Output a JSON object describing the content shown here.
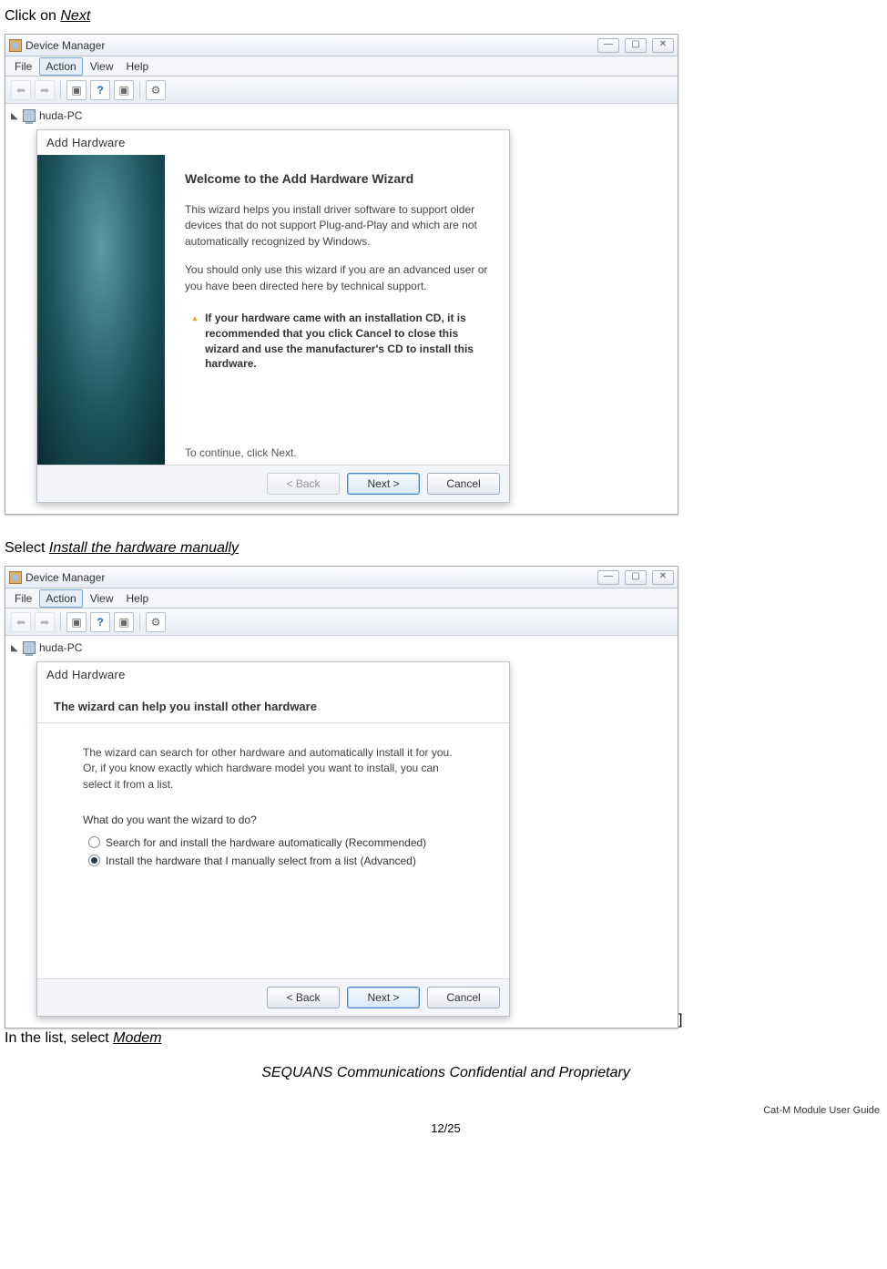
{
  "instruction1_prefix": "Click on ",
  "instruction1_link": "Next",
  "instruction2_prefix": "Select ",
  "instruction2_link": "Install the hardware manually",
  "instruction3_prefix": "In the list, select ",
  "instruction3_link": "Modem",
  "bracket": "]",
  "footer_confidential": "SEQUANS Communications Confidential and Proprietary",
  "footer_right": "Cat-M Module User Guide",
  "footer_page": "12/25",
  "window": {
    "title": "Device Manager",
    "min": "—",
    "max": "▢",
    "close": "✕",
    "menus": {
      "file": "File",
      "action": "Action",
      "view": "View",
      "help": "Help"
    },
    "tree_node": "huda-PC"
  },
  "dialog1": {
    "title": "Add Hardware",
    "heading": "Welcome to the Add Hardware Wizard",
    "p1": "This wizard helps you install driver software to support older devices that do not support Plug-and-Play and which are not automatically recognized by Windows.",
    "p2": "You should only use this wizard if you are an advanced user or you have been directed here by technical support.",
    "warn": "If your hardware came with an installation CD, it is recommended that you click Cancel to close this wizard and use the manufacturer's CD to install this hardware.",
    "continue": "To continue, click Next.",
    "back": "< Back",
    "next": "Next >",
    "cancel": "Cancel"
  },
  "dialog2": {
    "title": "Add Hardware",
    "heading": "The wizard can help you install other hardware",
    "p1": "The wizard can search for other hardware and automatically install it for you. Or, if you know exactly which hardware model you want to install, you can select it from a list.",
    "q": "What do you want the wizard to do?",
    "opt1": "Search for and install the hardware automatically (Recommended)",
    "opt2": "Install the hardware that I manually select from a list (Advanced)",
    "back": "< Back",
    "next": "Next >",
    "cancel": "Cancel"
  }
}
